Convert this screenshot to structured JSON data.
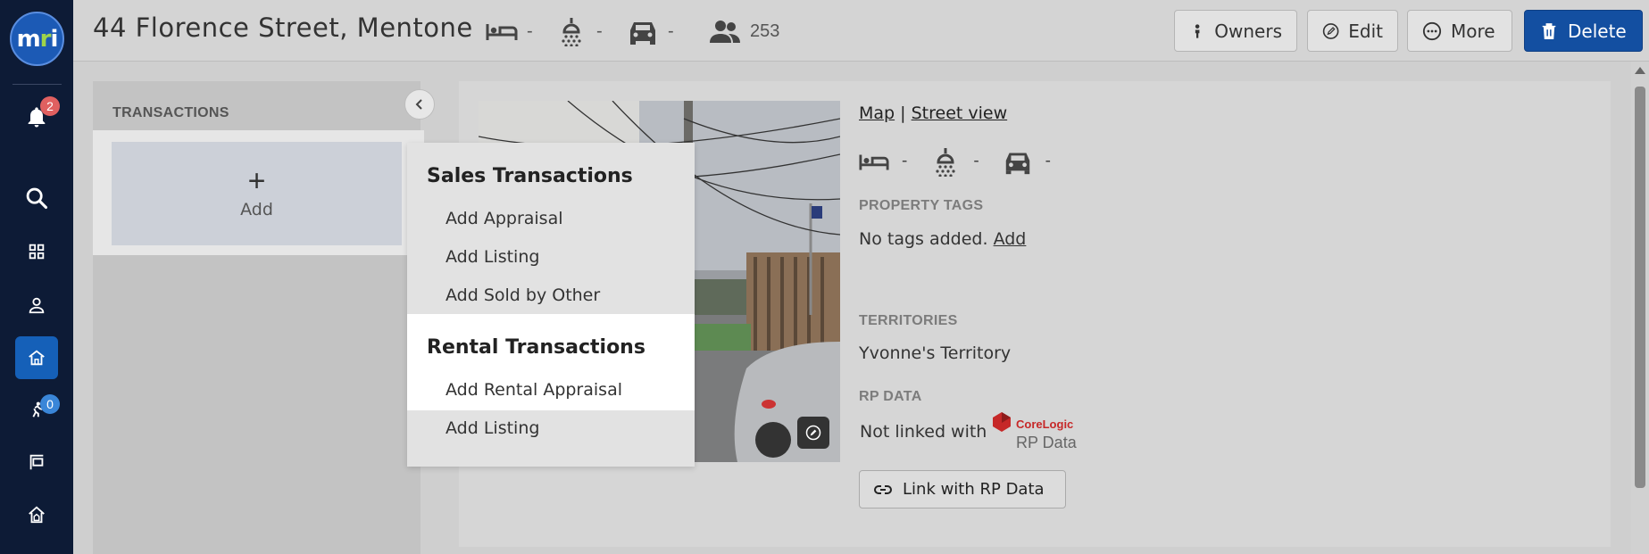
{
  "sidebar": {
    "logo_text_m": "m",
    "logo_text_r": "r",
    "logo_text_i": "i",
    "notifications_badge": "2",
    "tasks_badge": "0",
    "items": [
      {
        "icon": "bell-icon"
      },
      {
        "icon": "search-icon"
      },
      {
        "icon": "grid-icon"
      },
      {
        "icon": "person-icon"
      },
      {
        "icon": "house-icon",
        "active": true
      },
      {
        "icon": "runner-icon"
      },
      {
        "icon": "sign-icon"
      },
      {
        "icon": "home-outline-icon"
      }
    ]
  },
  "header": {
    "title": "44 Florence Street, Mentone",
    "beds": "-",
    "baths": "-",
    "cars": "-",
    "contacts": "253",
    "buttons": {
      "owners": "Owners",
      "edit": "Edit",
      "more": "More",
      "delete": "Delete"
    }
  },
  "transactions": {
    "title": "TRANSACTIONS",
    "add_label": "Add",
    "add_symbol": "+"
  },
  "dropdown": {
    "sales_heading": "Sales Transactions",
    "sales_items": [
      "Add Appraisal",
      "Add Listing",
      "Add Sold by Other"
    ],
    "rental_heading": "Rental Transactions",
    "rental_items": [
      "Add Rental Appraisal",
      "Add Listing"
    ]
  },
  "property": {
    "map_link": "Map",
    "separator": "|",
    "street_view_link": "Street view",
    "beds": "-",
    "baths": "-",
    "cars": "-",
    "tags_label": "PROPERTY TAGS",
    "tags_text": "No tags added.",
    "tags_add": "Add",
    "territories_label": "TERRITORIES",
    "territory": "Yvonne's Territory",
    "rpdata_label": "RP DATA",
    "rpdata_status": "Not linked with",
    "corelogic_text": "CoreLogic",
    "rpdata_logo_text": "RP Data",
    "link_button": "Link with RP Data"
  }
}
